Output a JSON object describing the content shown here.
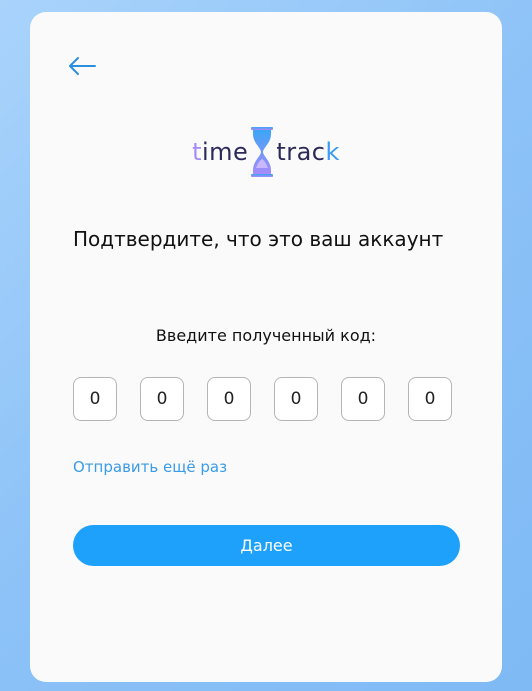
{
  "colors": {
    "accent": "#1da1fb",
    "link": "#3a9be8",
    "card": "#fafafa"
  },
  "header": {
    "back_icon": "arrow-left-icon"
  },
  "logo": {
    "part1_first": "t",
    "part1_rest": "ime",
    "part2_main": "trac",
    "part2_last": "k",
    "icon": "hourglass-icon"
  },
  "title": "Подтвердите, что это ваш аккаунт",
  "code": {
    "label": "Введите полученный код:",
    "digits": [
      "0",
      "0",
      "0",
      "0",
      "0",
      "0"
    ]
  },
  "resend_label": "Отправить ещё раз",
  "next_label": "Далее"
}
